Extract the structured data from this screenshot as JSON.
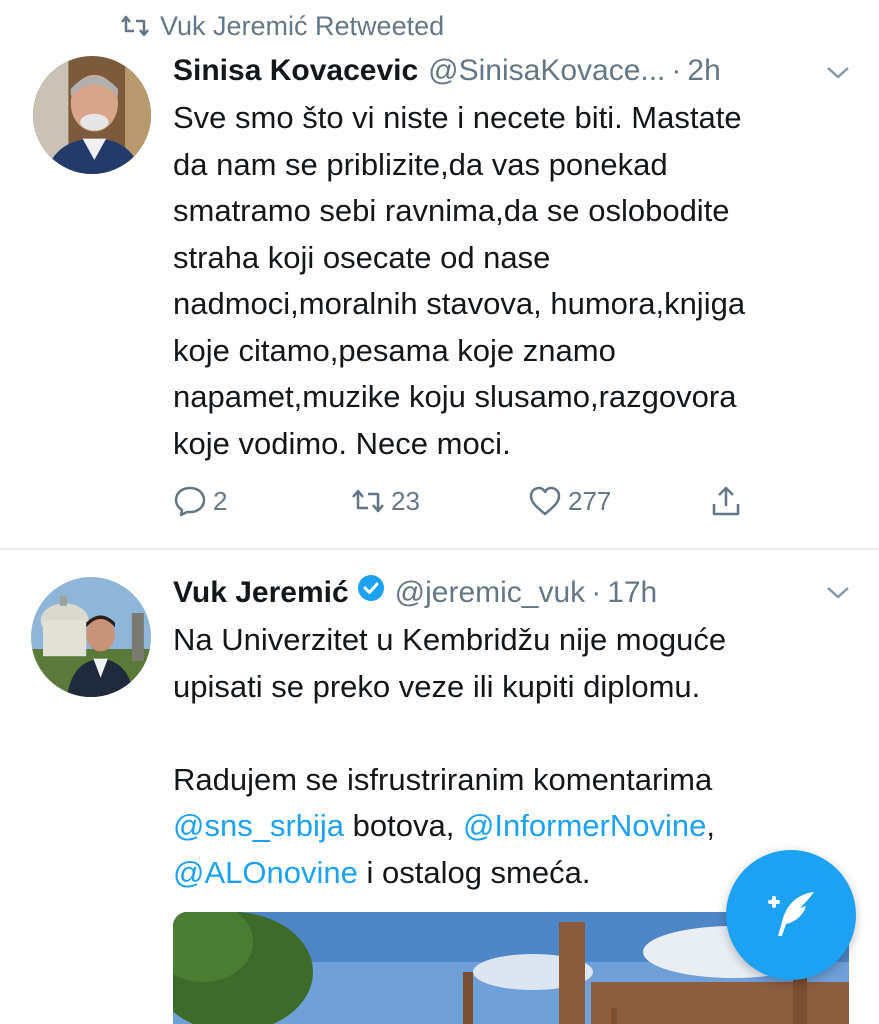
{
  "retweet_banner": {
    "text": "Vuk Jeremić Retweeted",
    "icon": "retweet-icon"
  },
  "tweet1": {
    "name": "Sinisa Kovacevic",
    "handle": "@SinisaKovace...",
    "sep": "·",
    "time": "2h",
    "lines": [
      "Sve smo što vi niste i necete biti. Mastate",
      "da nam se priblizite,da vas ponekad",
      "smatramo sebi ravnima,da se oslobodite",
      "straha koji osecate od nase",
      "nadmoci,moralnih stavova, humora,knjiga",
      "koje citamo,pesama koje znamo",
      "napamet,muzike koju slusamo,razgovora",
      "koje vodimo. Nece moci."
    ],
    "replies": "2",
    "retweets": "23",
    "likes": "277"
  },
  "tweet2": {
    "name": "Vuk Jeremić",
    "handle": "@jeremic_vuk",
    "sep": "·",
    "time": "17h",
    "line1": "Na Univerzitet u Kembridžu nije moguće",
    "line2": "upisati se preko veze ili kupiti diplomu.",
    "line3": "Radujem se isfrustriranim komentarima",
    "mention1": "@sns_srbija",
    "text4": " botova, ",
    "mention2": "@InformerNovine",
    "comma": ",",
    "mention3": "@ALOnovine",
    "text5": " i ostalog smeća."
  },
  "colors": {
    "accent": "#1da1f2",
    "muted": "#657786",
    "text": "#14171a"
  }
}
